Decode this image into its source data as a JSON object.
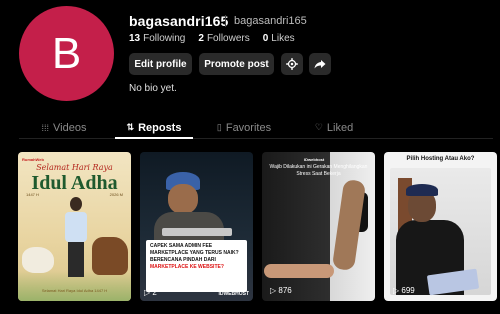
{
  "profile": {
    "avatar_letter": "B",
    "username": "bagasandri165",
    "nickname": "bagasandri165",
    "bio": "No bio yet."
  },
  "stats": {
    "following_count": "13",
    "following_label": "Following",
    "followers_count": "2",
    "followers_label": "Followers",
    "likes_count": "0",
    "likes_label": "Likes"
  },
  "actions": {
    "edit_label": "Edit profile",
    "promote_label": "Promote post",
    "settings_icon": "gear-icon",
    "share_icon": "share-icon"
  },
  "tabs": [
    {
      "label": "Videos",
      "icon": "grid-icon",
      "active": false
    },
    {
      "label": "Reposts",
      "icon": "repost-icon",
      "active": true
    },
    {
      "label": "Favorites",
      "icon": "bookmark-icon",
      "active": false
    },
    {
      "label": "Liked",
      "icon": "heart-icon",
      "active": false
    }
  ],
  "videos": [
    {
      "brand": "RumahWeb",
      "subtitle": "Selamat Hari Raya",
      "title": "Idul Adha",
      "year_left": "1447 H",
      "year_right": "2026 M",
      "caption": "Selamat Hari Raya Idul Adha 1447 H"
    },
    {
      "note_lines": [
        "CAPEK SAMA ADMIN FEE",
        "MARKETPLACE YANG TERUS NAIK?",
        "BERENCANA PINDAH DARI",
        "MARKETPLACE KE WEBSITE?"
      ],
      "views": "2",
      "watermark": "IDWEBHOST"
    },
    {
      "brand": "IDwebhost",
      "headline": "Wajib Dilakukan ini Gerakan Menghilangkan Stress Saat Bekerja",
      "views": "876"
    },
    {
      "title": "Pilih Hosting Atau Ako?",
      "views": "699"
    }
  ],
  "colors": {
    "avatar_bg": "#c41f4a",
    "background": "#000000",
    "button_bg": "#2a2a2a"
  }
}
